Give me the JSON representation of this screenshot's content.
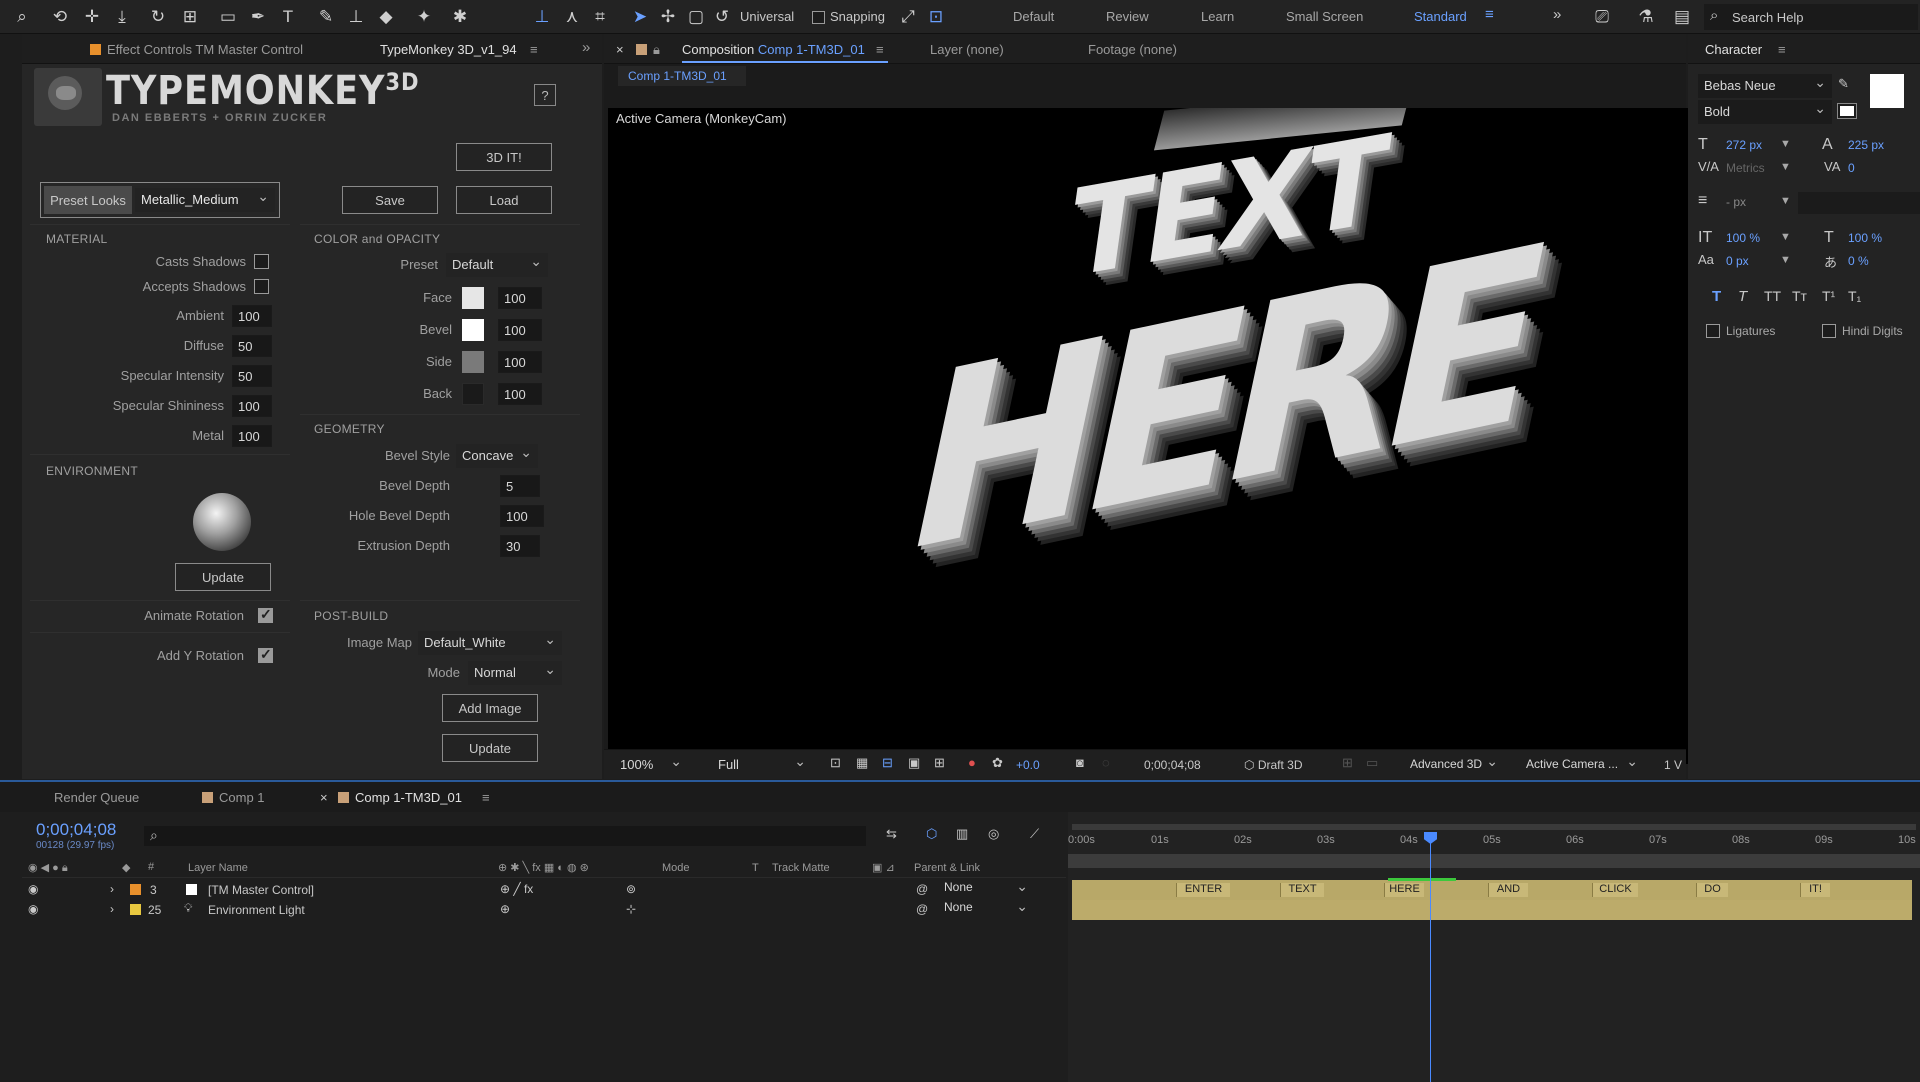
{
  "toolbar": {
    "tool_icons": [
      "zoom-icon",
      "orbit-icon",
      "pan-icon",
      "dolly-icon",
      "rotate-icon",
      "anchor-icon",
      "rect-icon",
      "pen-icon",
      "type-icon",
      "brush-icon",
      "stamp-icon",
      "eraser-icon",
      "roto-icon",
      "puppet-icon"
    ],
    "universal_label": "Universal",
    "snapping_label": "Snapping",
    "workspaces": [
      "Default",
      "Review",
      "Learn",
      "Small Screen",
      "Standard"
    ],
    "active_workspace": "Standard",
    "search_placeholder": "Search Help"
  },
  "effect_panel": {
    "tab_effect": "Effect Controls TM Master Control",
    "tab_plugin": "TypeMonkey 3D_v1_94",
    "logo_title": "TYPEMONKEY",
    "logo_sup": "3D",
    "logo_sub": "DAN EBBERTS + ORRIN ZUCKER",
    "help_label": "?",
    "btn_3dit": "3D IT!",
    "btn_save": "Save",
    "btn_load": "Load",
    "preset_looks_label": "Preset Looks",
    "preset_looks_value": "Metallic_Medium",
    "material": {
      "title": "MATERIAL",
      "casts_shadows": "Casts Shadows",
      "accepts_shadows": "Accepts Shadows",
      "ambient_label": "Ambient",
      "ambient": "100",
      "diffuse_label": "Diffuse",
      "diffuse": "50",
      "spec_int_label": "Specular Intensity",
      "spec_int": "50",
      "spec_shine_label": "Specular Shininess",
      "spec_shine": "100",
      "metal_label": "Metal",
      "metal": "100"
    },
    "environment": {
      "title": "ENVIRONMENT",
      "update": "Update",
      "animate_rotation": "Animate Rotation",
      "add_y_rotation": "Add Y Rotation"
    },
    "color": {
      "title": "COLOR and OPACITY",
      "preset_label": "Preset",
      "preset": "Default",
      "face_label": "Face",
      "face": "100",
      "face_color": "#e6e6e6",
      "bevel_label": "Bevel",
      "bevel": "100",
      "bevel_color": "#ffffff",
      "side_label": "Side",
      "side": "100",
      "side_color": "#7a7a7a",
      "back_label": "Back",
      "back": "100",
      "back_color": "#1a1a1a"
    },
    "geometry": {
      "title": "GEOMETRY",
      "bevel_style_label": "Bevel Style",
      "bevel_style": "Concave",
      "bevel_depth_label": "Bevel Depth",
      "bevel_depth": "5",
      "hole_bevel_label": "Hole Bevel Depth",
      "hole_bevel": "100",
      "extrusion_label": "Extrusion Depth",
      "extrusion": "30"
    },
    "postbuild": {
      "title": "POST-BUILD",
      "image_map_label": "Image Map",
      "image_map": "Default_White",
      "mode_label": "Mode",
      "mode": "Normal",
      "add_image": "Add Image",
      "update": "Update"
    }
  },
  "comp_panel": {
    "tab_comp_prefix": "Composition",
    "tab_comp_name": "Comp 1-TM3D_01",
    "tab_layer": "Layer (none)",
    "tab_footage": "Footage (none)",
    "breadcrumb": "Comp 1-TM3D_01",
    "camera_label": "Active Camera (MonkeyCam)",
    "text_line1": "TEXT",
    "text_line2": "HERE",
    "bottom": {
      "zoom": "100%",
      "resolution": "Full",
      "exposure": "+0.0",
      "timecode": "0;00;04;08",
      "draft": "Draft 3D",
      "renderer": "Advanced 3D",
      "camera": "Active Camera ...",
      "views": "1 V"
    }
  },
  "character": {
    "title": "Character",
    "font": "Bebas Neue",
    "style": "Bold",
    "size": "272 px",
    "leading": "225 px",
    "kerning": "Metrics",
    "tracking": "0",
    "stroke": "- px",
    "vscale": "100 %",
    "hscale": "100 %",
    "baseline": "0 px",
    "tsume": "0 %",
    "ligatures": "Ligatures",
    "hindi_digits": "Hindi Digits",
    "fill_color": "#ffffff"
  },
  "timeline": {
    "tab_render": "Render Queue",
    "tab_comp1": "Comp 1",
    "tab_active": "Comp 1-TM3D_01",
    "timecode": "0;00;04;08",
    "frames": "00128 (29.97 fps)",
    "col_layer_name": "Layer Name",
    "col_mode": "Mode",
    "col_t": "T",
    "col_track_matte": "Track Matte",
    "col_parent": "Parent & Link",
    "ruler": [
      "0:00s",
      "01s",
      "02s",
      "03s",
      "04s",
      "05s",
      "06s",
      "07s",
      "08s",
      "09s",
      "10s"
    ],
    "layers": [
      {
        "num": "3",
        "name": "[TM Master Control]",
        "parent": "None",
        "label_color": "#e8902c"
      },
      {
        "num": "25",
        "name": "Environment Light",
        "parent": "None",
        "label_color": "#e8c840"
      }
    ],
    "markers": [
      "ENTER",
      "TEXT",
      "HERE",
      "AND",
      "CLICK",
      "DO",
      "IT!"
    ]
  }
}
